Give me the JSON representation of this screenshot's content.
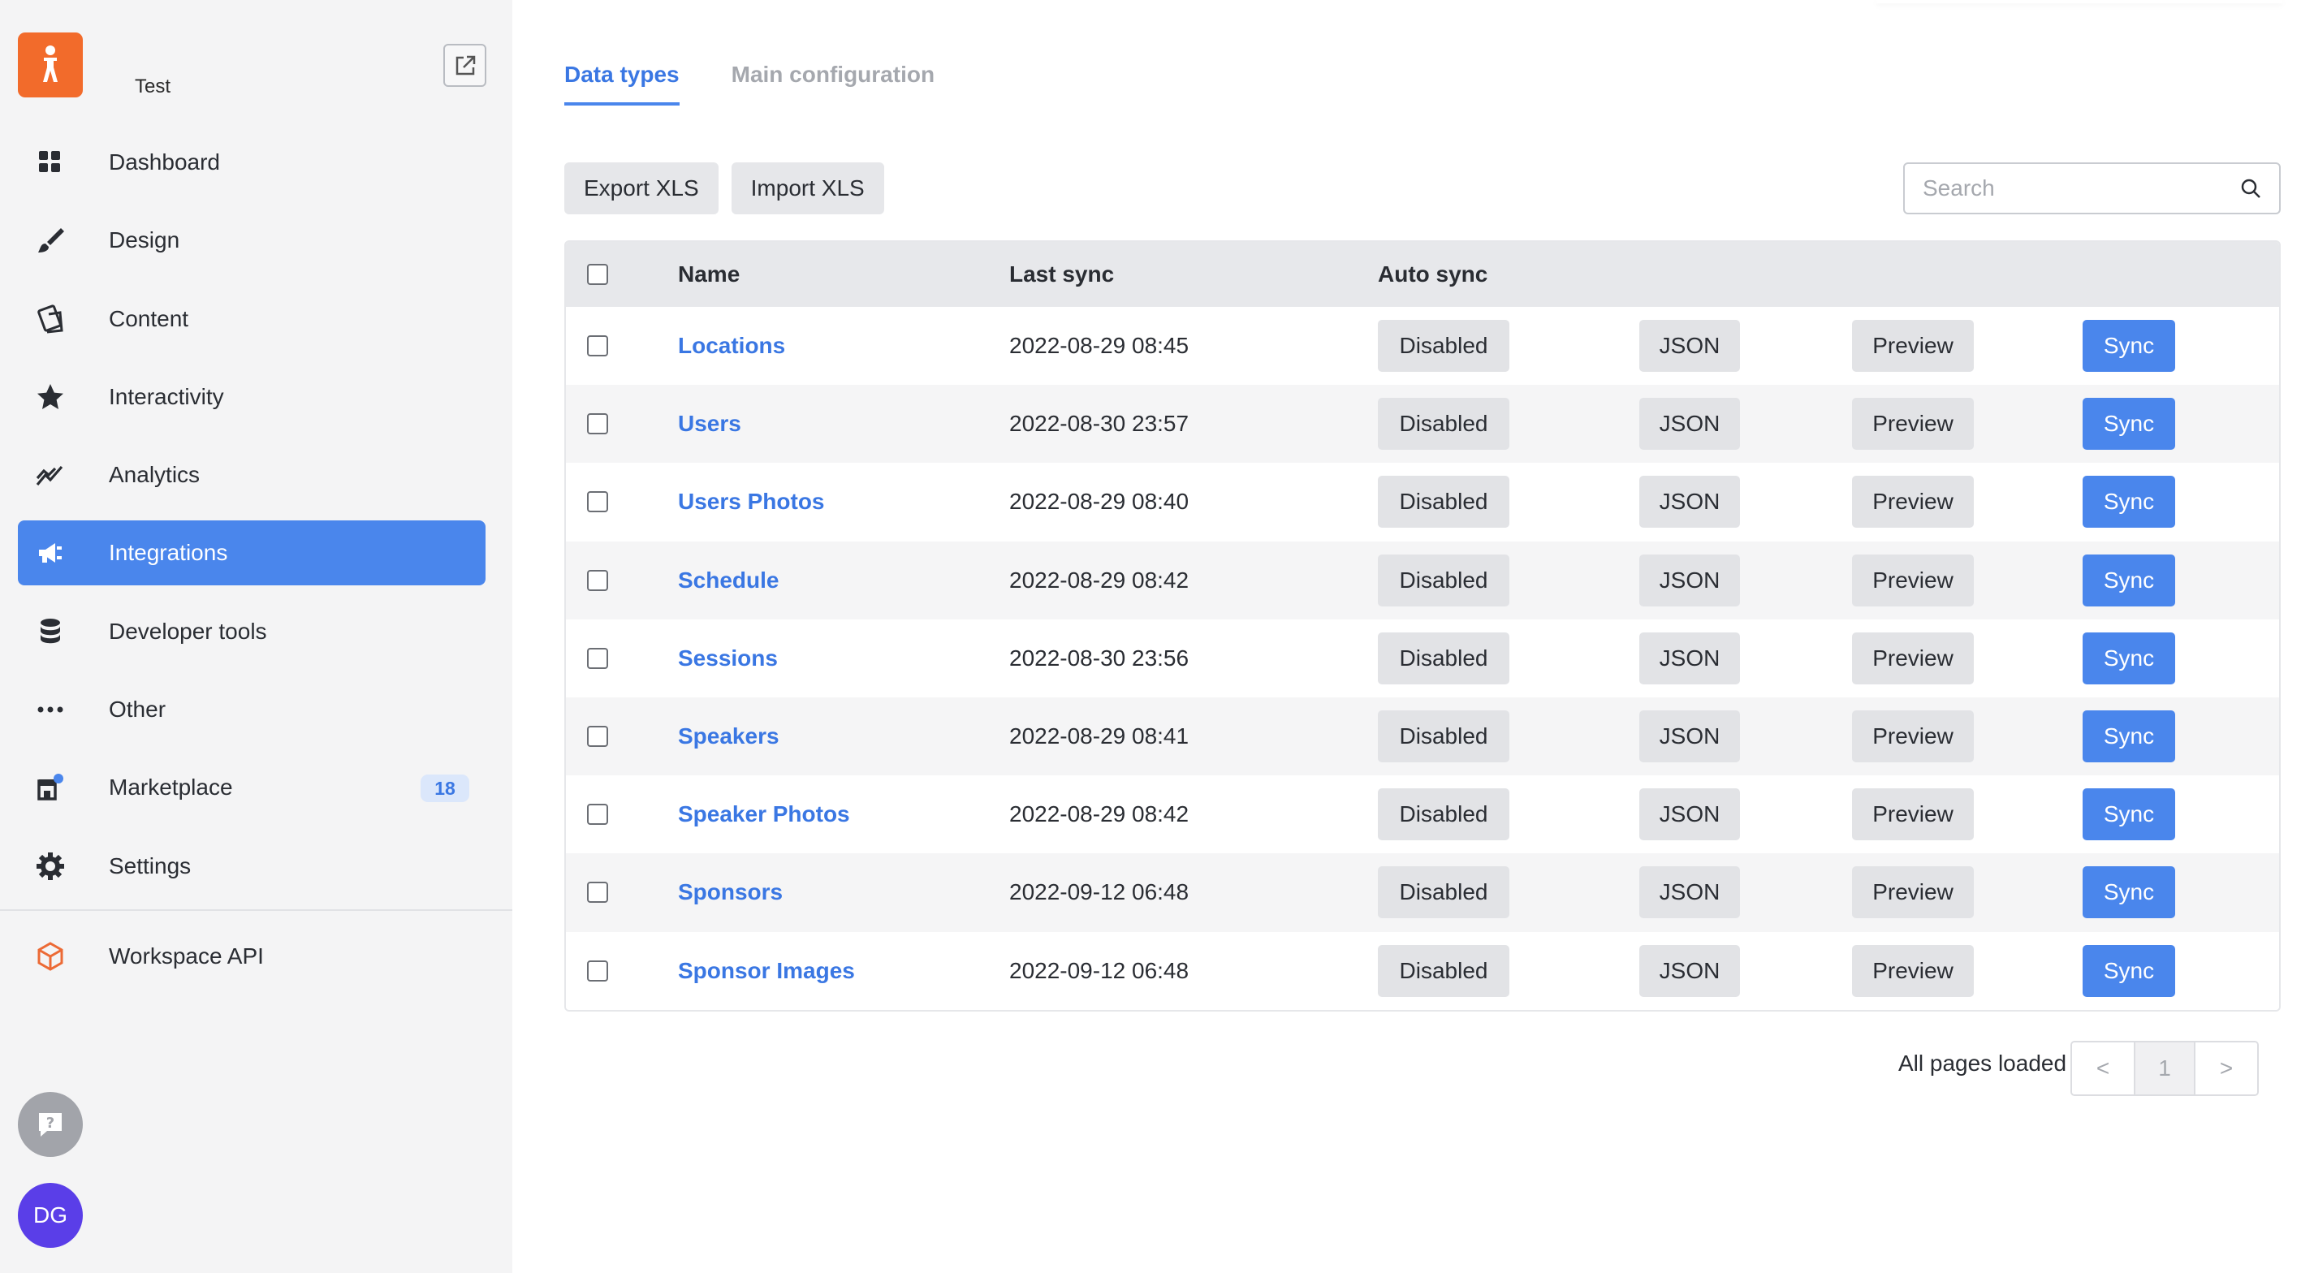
{
  "brand": {
    "name": "Test",
    "color": "#f26b2b"
  },
  "sidebar": {
    "items": [
      {
        "label": "Dashboard",
        "icon": "grid-icon"
      },
      {
        "label": "Design",
        "icon": "brush-icon"
      },
      {
        "label": "Content",
        "icon": "pages-icon"
      },
      {
        "label": "Interactivity",
        "icon": "star-icon"
      },
      {
        "label": "Analytics",
        "icon": "chart-line-icon"
      },
      {
        "label": "Integrations",
        "icon": "plug-icon",
        "active": true
      },
      {
        "label": "Developer tools",
        "icon": "database-icon"
      },
      {
        "label": "Other",
        "icon": "dots-icon"
      },
      {
        "label": "Marketplace",
        "icon": "store-icon",
        "badge": "18"
      },
      {
        "label": "Settings",
        "icon": "gear-icon"
      }
    ],
    "bottom_items": [
      {
        "label": "Workspace API",
        "icon": "cube-icon"
      }
    ],
    "avatar_initials": "DG",
    "accent": "#4a86ec"
  },
  "tabs": [
    {
      "label": "Data types",
      "active": true
    },
    {
      "label": "Main configuration",
      "active": false
    }
  ],
  "toolbar": {
    "export_label": "Export XLS",
    "import_label": "Import XLS"
  },
  "search": {
    "placeholder": "Search"
  },
  "table": {
    "headers": {
      "name": "Name",
      "last_sync": "Last sync",
      "auto_sync": "Auto sync"
    },
    "rows": [
      {
        "name": "Locations",
        "last_sync": "2022-08-29 08:45",
        "auto_sync": "Disabled",
        "json": "JSON",
        "preview": "Preview",
        "sync": "Sync"
      },
      {
        "name": "Users",
        "last_sync": "2022-08-30 23:57",
        "auto_sync": "Disabled",
        "json": "JSON",
        "preview": "Preview",
        "sync": "Sync"
      },
      {
        "name": "Users Photos",
        "last_sync": "2022-08-29 08:40",
        "auto_sync": "Disabled",
        "json": "JSON",
        "preview": "Preview",
        "sync": "Sync"
      },
      {
        "name": "Schedule",
        "last_sync": "2022-08-29 08:42",
        "auto_sync": "Disabled",
        "json": "JSON",
        "preview": "Preview",
        "sync": "Sync"
      },
      {
        "name": "Sessions",
        "last_sync": "2022-08-30 23:56",
        "auto_sync": "Disabled",
        "json": "JSON",
        "preview": "Preview",
        "sync": "Sync"
      },
      {
        "name": "Speakers",
        "last_sync": "2022-08-29 08:41",
        "auto_sync": "Disabled",
        "json": "JSON",
        "preview": "Preview",
        "sync": "Sync"
      },
      {
        "name": "Speaker Photos",
        "last_sync": "2022-08-29 08:42",
        "auto_sync": "Disabled",
        "json": "JSON",
        "preview": "Preview",
        "sync": "Sync"
      },
      {
        "name": "Sponsors",
        "last_sync": "2022-09-12 06:48",
        "auto_sync": "Disabled",
        "json": "JSON",
        "preview": "Preview",
        "sync": "Sync"
      },
      {
        "name": "Sponsor Images",
        "last_sync": "2022-09-12 06:48",
        "auto_sync": "Disabled",
        "json": "JSON",
        "preview": "Preview",
        "sync": "Sync"
      }
    ]
  },
  "pager": {
    "status": "All pages loaded",
    "prev": "<",
    "current": "1",
    "next": ">"
  }
}
